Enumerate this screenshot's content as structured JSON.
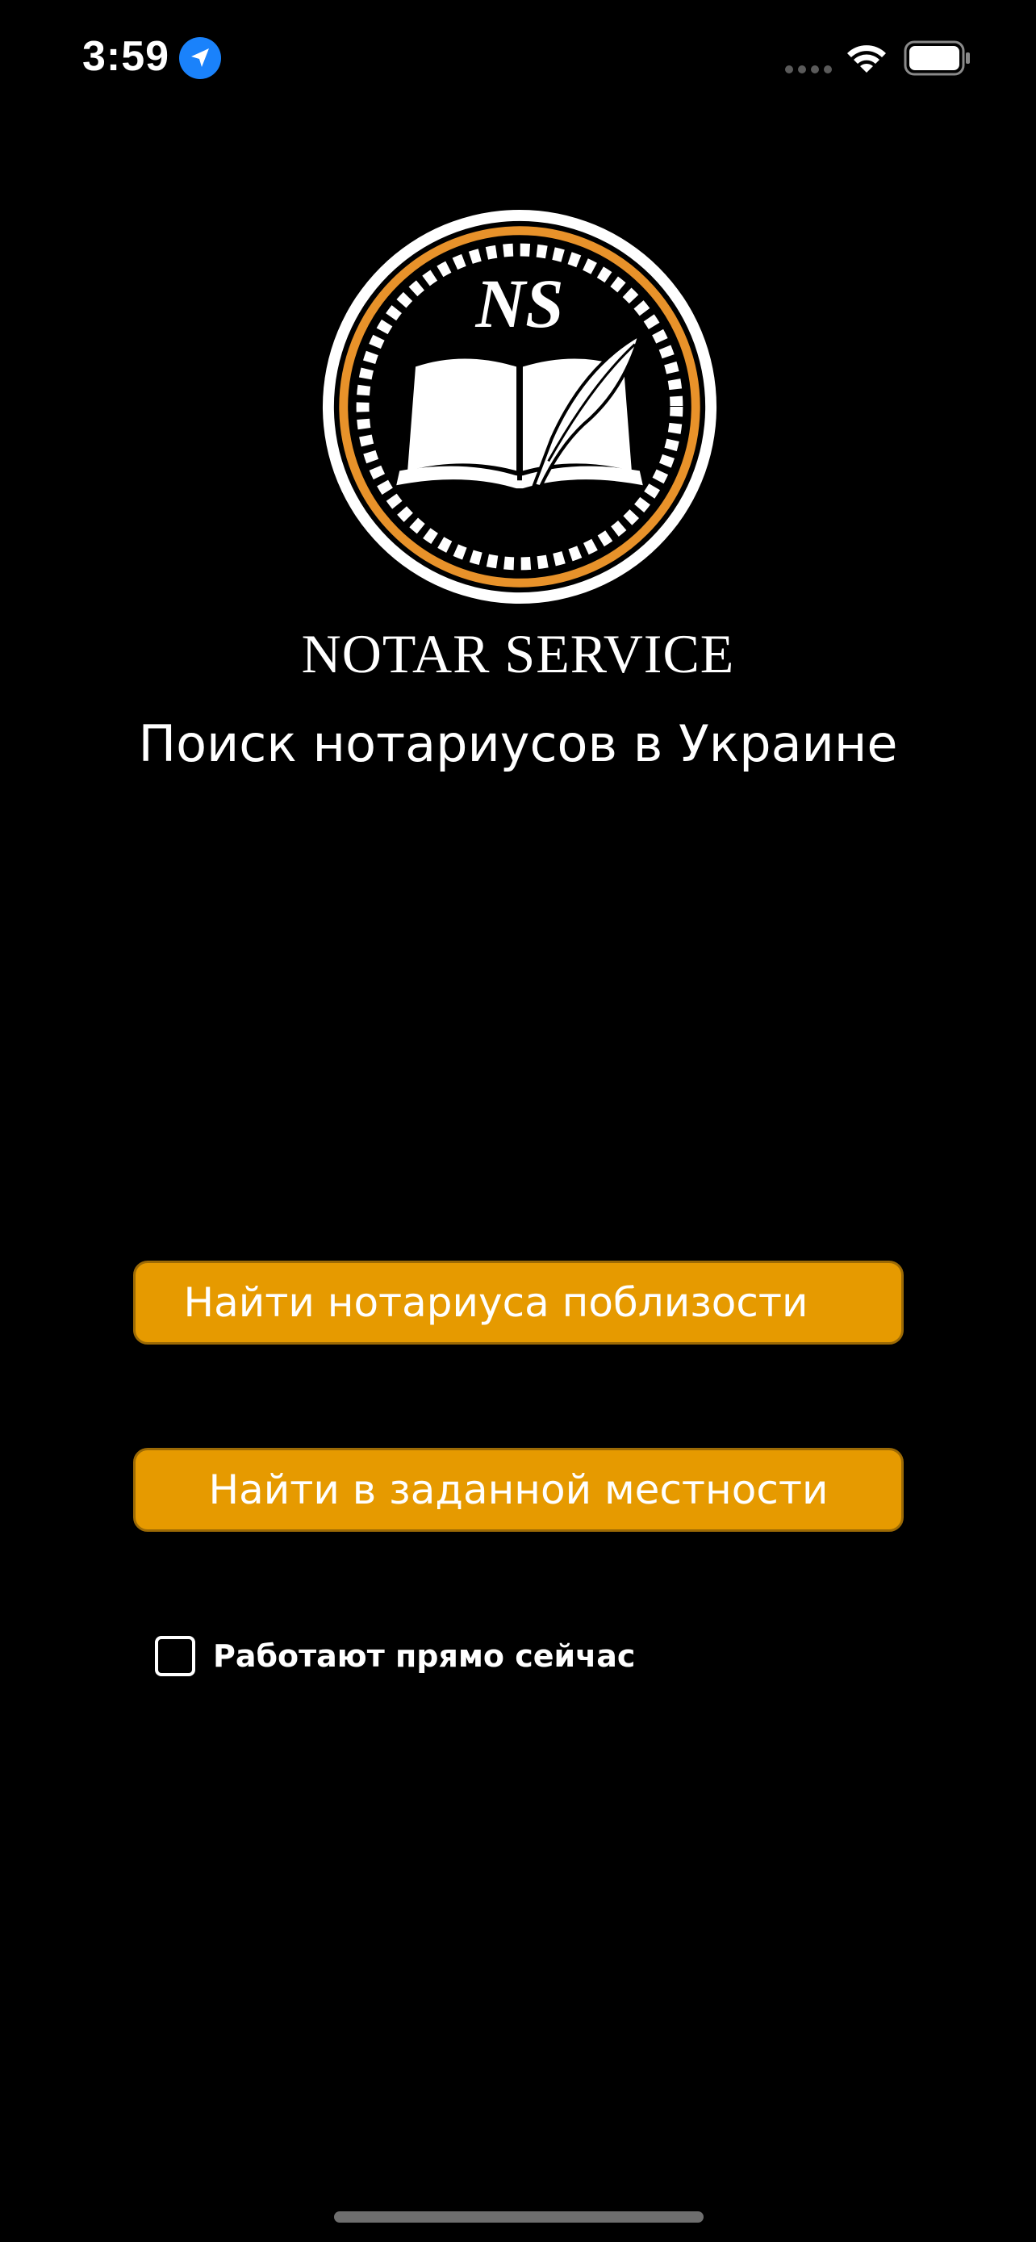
{
  "status_bar": {
    "time": "3:59",
    "icons": [
      "location-arrow-icon",
      "cellular-signal-icon",
      "wifi-icon",
      "battery-icon"
    ]
  },
  "logo": {
    "monogram": "NS",
    "icon": "book-and-quill-emblem",
    "ring_color": "#e8922a"
  },
  "brand": {
    "name": "NOTAR SERVICE",
    "tagline": "Поиск нотариусов в Украине"
  },
  "actions": {
    "find_nearby_label": "Найти нотариуса поблизости",
    "find_in_area_label": "Найти в заданной местности"
  },
  "filters": {
    "open_now_label": "Работают прямо сейчас",
    "open_now_checked": false
  },
  "colors": {
    "background": "#000000",
    "button_fill": "#e69a00",
    "button_border": "#9c6a05",
    "text": "#ffffff",
    "location_badge": "#1a82fb"
  }
}
